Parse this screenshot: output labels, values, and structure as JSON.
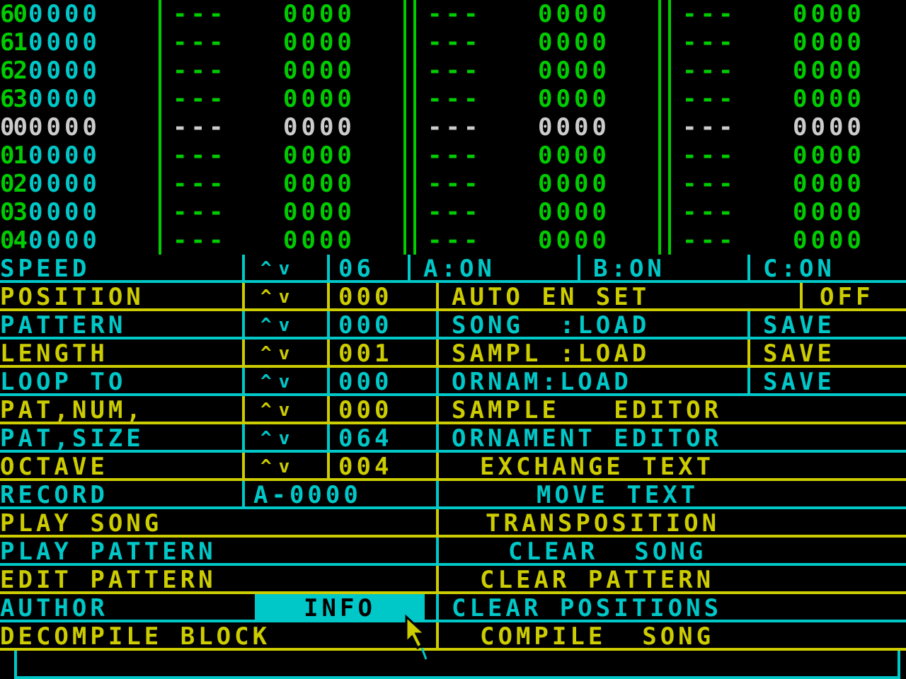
{
  "colors": {
    "green": "#00cc00",
    "cyan": "#00c8c8",
    "white": "#cccccc",
    "yellow": "#cccc00",
    "black": "#000000"
  },
  "pattern": {
    "rows": [
      {
        "num": "60",
        "cur": false,
        "cols": [
          "0000",
          "---",
          "0000",
          "---",
          "0000",
          "---",
          "0000"
        ]
      },
      {
        "num": "61",
        "cur": false,
        "cols": [
          "0000",
          "---",
          "0000",
          "---",
          "0000",
          "---",
          "0000"
        ]
      },
      {
        "num": "62",
        "cur": false,
        "cols": [
          "0000",
          "---",
          "0000",
          "---",
          "0000",
          "---",
          "0000"
        ]
      },
      {
        "num": "63",
        "cur": false,
        "cols": [
          "0000",
          "---",
          "0000",
          "---",
          "0000",
          "---",
          "0000"
        ]
      },
      {
        "num": "00",
        "cur": true,
        "cols": [
          "0000",
          "---",
          "0000",
          "---",
          "0000",
          "---",
          "0000"
        ]
      },
      {
        "num": "01",
        "cur": false,
        "cols": [
          "0000",
          "---",
          "0000",
          "---",
          "0000",
          "---",
          "0000"
        ]
      },
      {
        "num": "02",
        "cur": false,
        "cols": [
          "0000",
          "---",
          "0000",
          "---",
          "0000",
          "---",
          "0000"
        ]
      },
      {
        "num": "03",
        "cur": false,
        "cols": [
          "0000",
          "---",
          "0000",
          "---",
          "0000",
          "---",
          "0000"
        ]
      },
      {
        "num": "04",
        "cur": false,
        "cols": [
          "0000",
          "---",
          "0000",
          "---",
          "0000",
          "---",
          "0000"
        ]
      }
    ]
  },
  "menu": {
    "speed": {
      "label": "SPEED",
      "arrows": "^v",
      "value": "06",
      "a": "A:ON",
      "b": "B:ON",
      "c": "C:ON"
    },
    "position": {
      "label": "POSITION",
      "arrows": "^v",
      "value": "000",
      "auto": "AUTO EN SET",
      "state": "OFF"
    },
    "pattern": {
      "label": "PATTERN",
      "arrows": "^v",
      "value": "000",
      "song": "SONG  :LOAD",
      "save": "SAVE"
    },
    "length": {
      "label": "LENGTH",
      "arrows": "^v",
      "value": "001",
      "sampl": "SAMPL :LOAD",
      "save": "SAVE"
    },
    "loop": {
      "label": "LOOP TO",
      "arrows": "^v",
      "value": "000",
      "ornam": "ORNAM:LOAD",
      "save": "SAVE"
    },
    "patnum": {
      "label": "PAT,NUM,",
      "arrows": "^v",
      "value": "000",
      "right": "SAMPLE   EDITOR"
    },
    "patsize": {
      "label": "PAT,SIZE",
      "arrows": "^v",
      "value": "064",
      "right": "ORNAMENT EDITOR"
    },
    "octave": {
      "label": "OCTAVE",
      "arrows": "^v",
      "value": "004",
      "right": "EXCHANGE TEXT"
    },
    "record": {
      "label": "RECORD",
      "value": "A-0000",
      "right": "MOVE TEXT"
    },
    "playsong": {
      "label": "PLAY SONG",
      "right": "TRANSPOSITION"
    },
    "playpattern": {
      "label": "PLAY PATTERN",
      "right": "CLEAR  SONG"
    },
    "editpattern": {
      "label": "EDIT PATTERN",
      "right": "CLEAR PATTERN"
    },
    "author": {
      "label": "AUTHOR",
      "info": "INFO",
      "right": "CLEAR POSITIONS"
    },
    "decompile": {
      "label": "DECOMPILE BLOCK",
      "right": "COMPILE  SONG"
    }
  },
  "status_bar": {
    "text": ""
  }
}
